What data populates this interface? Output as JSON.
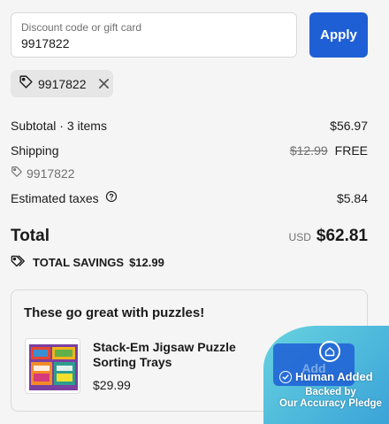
{
  "discount": {
    "label": "Discount code or gift card",
    "value": "9917822",
    "apply_label": "Apply"
  },
  "applied_chip": {
    "code": "9917822",
    "tag_icon": "tag-icon",
    "remove_icon": "close-icon"
  },
  "summary": {
    "subtotal_label": "Subtotal · 3 items",
    "subtotal_value": "$56.97",
    "shipping_label": "Shipping",
    "shipping_original": "$12.99",
    "shipping_value": "FREE",
    "shipping_code": "9917822",
    "taxes_label": "Estimated taxes",
    "taxes_info_icon": "help-circle-icon",
    "taxes_value": "$5.84",
    "total_label": "Total",
    "currency": "USD",
    "total_value": "$62.81",
    "savings_label": "TOTAL SAVINGS",
    "savings_value": "$12.99"
  },
  "upsell": {
    "title": "These go great with puzzles!",
    "product_name": "Stack-Em Jigsaw Puzzle Sorting Trays",
    "product_price": "$29.99",
    "add_label": "Add"
  },
  "badge": {
    "main": "Human Added",
    "sub_line1": "Backed by",
    "sub_line2": "Our Accuracy Pledge",
    "check_icon": "check-circle-icon",
    "home_icon": "home-icon",
    "gradient_start": "#67d3e0",
    "gradient_end": "#3aa3d8"
  },
  "colors": {
    "accent": "#1f5fd6",
    "background": "#f5f5f5"
  }
}
